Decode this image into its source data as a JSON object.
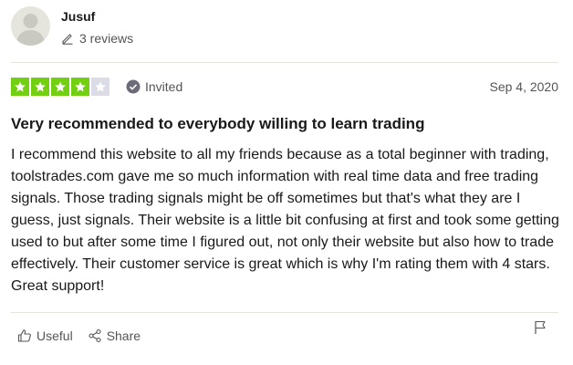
{
  "reviewer": {
    "name": "Jusuf",
    "reviews_count_label": "3 reviews"
  },
  "rating": {
    "stars": 4,
    "max_stars": 5,
    "filled_color": "#73cf11",
    "empty_color": "#dcdce6"
  },
  "badge": {
    "label": "Invited",
    "icon": "check-circle-icon"
  },
  "date": "Sep 4, 2020",
  "review": {
    "title": "Very recommended to everybody willing to learn trading",
    "body": "I recommend this website to all my friends because as a total beginner with trading, toolstrades.com gave me so much information with real time data and free trading signals. Those trading signals might be off sometimes but that's what they are I guess, just signals. Their website is a little bit confusing at first and took some getting used to but after some time I figured out, not only their website but also how to trade effectively. Their customer service is great which is why I'm rating them with 4 stars. Great support!"
  },
  "actions": {
    "useful_label": "Useful",
    "share_label": "Share",
    "useful_icon": "thumbs-up-icon",
    "share_icon": "share-icon",
    "report_icon": "flag-icon"
  }
}
